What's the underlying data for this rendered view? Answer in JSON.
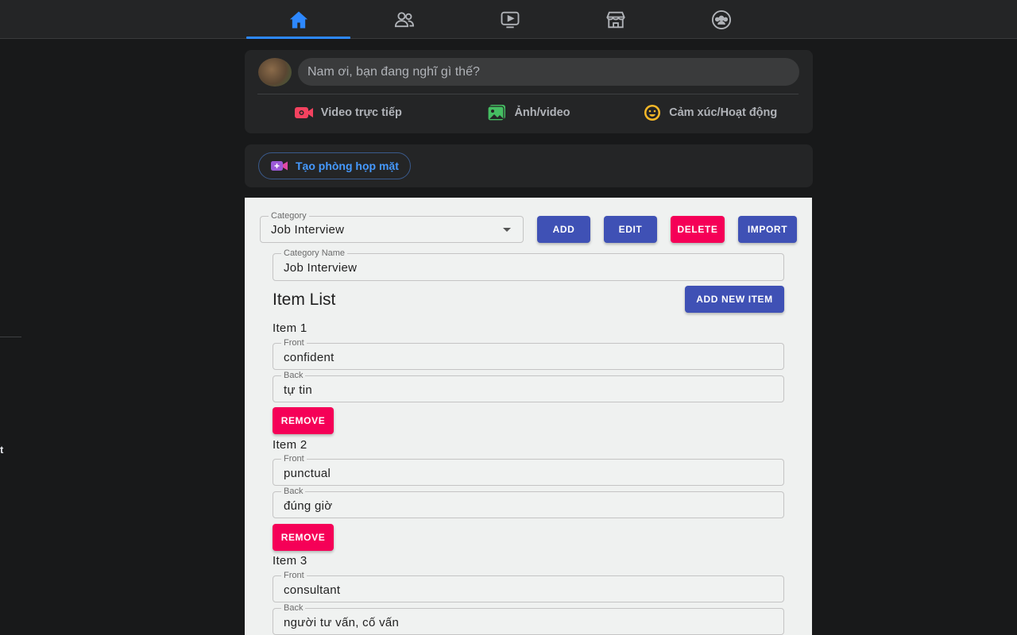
{
  "nav": {
    "tabs": [
      {
        "name": "home",
        "icon": "home-icon",
        "active": true
      },
      {
        "name": "friends",
        "icon": "friends-icon",
        "active": false
      },
      {
        "name": "watch",
        "icon": "video-icon",
        "active": false
      },
      {
        "name": "marketplace",
        "icon": "marketplace-icon",
        "active": false
      },
      {
        "name": "groups",
        "icon": "groups-icon",
        "active": false
      }
    ],
    "active_color": "#2d88ff"
  },
  "sidebar": {
    "cut_text": "́t"
  },
  "composer": {
    "placeholder": "Nam ơi, bạn đang nghĩ gì thế?",
    "actions": [
      {
        "label": "Video trực tiếp",
        "icon": "live-video-icon",
        "color": "#f3425f"
      },
      {
        "label": "Ảnh/video",
        "icon": "photo-icon",
        "color": "#45bd62"
      },
      {
        "label": "Cảm xúc/Hoạt động",
        "icon": "feeling-icon",
        "color": "#f7b928"
      }
    ]
  },
  "room": {
    "label": "Tạo phòng họp mặt",
    "icon": "room-video-icon"
  },
  "panel": {
    "category": {
      "legend": "Category",
      "value": "Job Interview"
    },
    "buttons": {
      "add": "ADD",
      "edit": "EDIT",
      "delete": "DELETE",
      "import": "IMPORT"
    },
    "category_name": {
      "legend": "Category Name",
      "value": "Job Interview"
    },
    "item_list_title": "Item List",
    "add_new_item": "ADD NEW ITEM",
    "front_legend": "Front",
    "back_legend": "Back",
    "remove_label": "REMOVE",
    "items": [
      {
        "title": "Item 1",
        "front": "confident",
        "back": "tự tin"
      },
      {
        "title": "Item 2",
        "front": "punctual",
        "back": "đúng giờ"
      },
      {
        "title": "Item 3",
        "front": "consultant",
        "back": "người tư vấn, cố vấn"
      }
    ],
    "colors": {
      "primary": "#3f51b5",
      "danger": "#f50057"
    }
  }
}
